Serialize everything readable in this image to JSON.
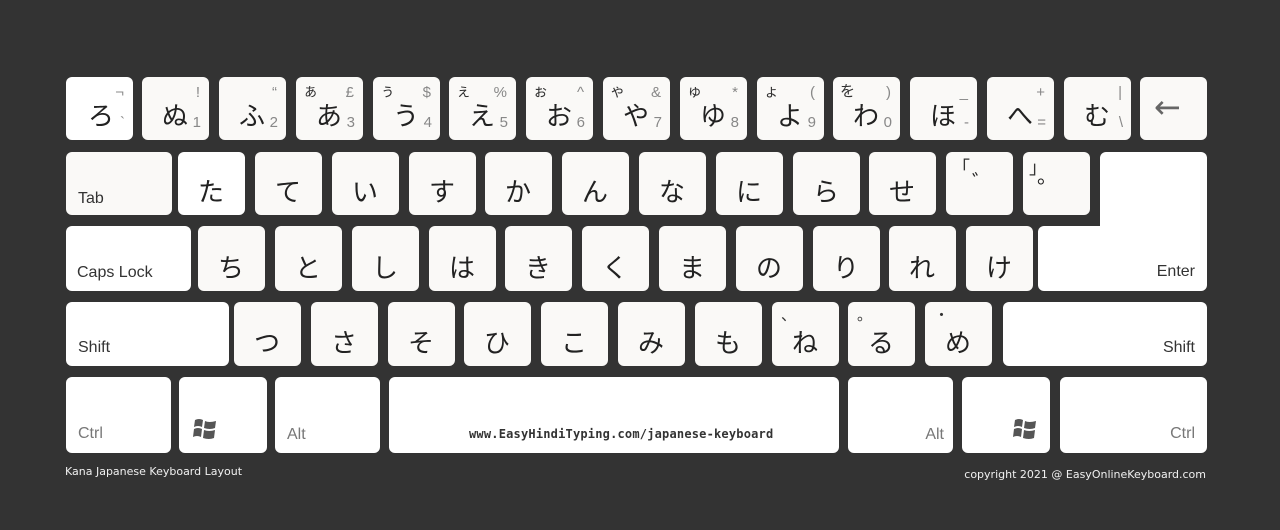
{
  "title": "Kana Japanese Keyboard Layout",
  "copyright": "copyright 2021 @ EasyOnlineKeyboard.com",
  "spacebar_label": "www.EasyHindiTyping.com/japanese-keyboard",
  "row1": [
    {
      "main": "ろ",
      "shift_kana": "",
      "top_right": "¬",
      "bottom_right": "`"
    },
    {
      "main": "ぬ",
      "shift_kana": "",
      "top_right": "!",
      "bottom_right": "1"
    },
    {
      "main": "ふ",
      "shift_kana": "",
      "top_right": "“",
      "bottom_right": "2"
    },
    {
      "main": "あ",
      "shift_kana": "ぁ",
      "top_right": "£",
      "bottom_right": "3"
    },
    {
      "main": "う",
      "shift_kana": "ぅ",
      "top_right": "$",
      "bottom_right": "4"
    },
    {
      "main": "え",
      "shift_kana": "ぇ",
      "top_right": "%",
      "bottom_right": "5"
    },
    {
      "main": "お",
      "shift_kana": "ぉ",
      "top_right": "^",
      "bottom_right": "6"
    },
    {
      "main": "や",
      "shift_kana": "ゃ",
      "top_right": "&",
      "bottom_right": "7"
    },
    {
      "main": "ゆ",
      "shift_kana": "ゅ",
      "top_right": "*",
      "bottom_right": "8"
    },
    {
      "main": "よ",
      "shift_kana": "ょ",
      "top_right": "(",
      "bottom_right": "9"
    },
    {
      "main": "わ",
      "shift_kana": "を",
      "top_right": ")",
      "bottom_right": "0"
    },
    {
      "main": "ほ",
      "shift_kana": "",
      "top_right": "_",
      "bottom_right": "-"
    },
    {
      "main": "へ",
      "shift_kana": "",
      "top_right": "+",
      "bottom_right": "="
    },
    {
      "main": "む",
      "shift_kana": "",
      "top_right": "|",
      "bottom_right": "\\"
    }
  ],
  "backspace_icon": "←",
  "tab_label": "Tab",
  "row2": [
    "た",
    "て",
    "い",
    "す",
    "か",
    "ん",
    "な",
    "に",
    "ら",
    "せ"
  ],
  "row2_extra": [
    {
      "top_left": "「",
      "main": "゛"
    },
    {
      "top_left": "」",
      "main": "。"
    }
  ],
  "caps_label": "Caps Lock",
  "row3": [
    "ち",
    "と",
    "し",
    "は",
    "き",
    "く",
    "ま",
    "の",
    "り",
    "れ",
    "け"
  ],
  "enter_label": "Enter",
  "shift_label": "Shift",
  "row4": [
    {
      "main": "つ",
      "top_left": ""
    },
    {
      "main": "さ",
      "top_left": ""
    },
    {
      "main": "そ",
      "top_left": ""
    },
    {
      "main": "ひ",
      "top_left": ""
    },
    {
      "main": "こ",
      "top_left": ""
    },
    {
      "main": "み",
      "top_left": ""
    },
    {
      "main": "も",
      "top_left": ""
    },
    {
      "main": "ね",
      "top_left": "、"
    },
    {
      "main": "る",
      "top_left": "。"
    },
    {
      "main": "め",
      "top_left": "・"
    }
  ],
  "ctrl_label": "Ctrl",
  "alt_label": "Alt",
  "win_icon": "windows-logo"
}
